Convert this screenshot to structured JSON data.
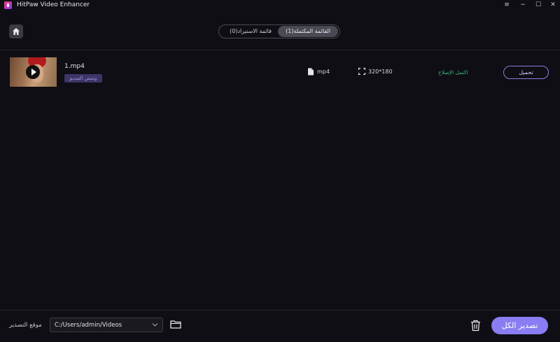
{
  "window": {
    "title": "HitPaw Video Enhancer"
  },
  "tabs": [
    {
      "label": "القائمة المكتملة(1)",
      "active": true
    },
    {
      "label": "قائمة الاستيراد(0)",
      "active": false
    }
  ],
  "file": {
    "name": "1.mp4",
    "tag": "ومبض الفيديو",
    "format": "mp4",
    "resolution": "320*180",
    "status": "اكتمل الإصلاح",
    "upload_label": "تحميل"
  },
  "footer": {
    "export_location_label": "موقع التصدير",
    "path_value": "C:/Users/admin/Videos",
    "export_all_label": "تصدير الكل"
  },
  "colors": {
    "accent": "#8a7cf2",
    "status_green": "#3fb87a",
    "background": "#0f0e14"
  },
  "icons": [
    "app-icon",
    "minimize-icon",
    "restore-icon",
    "close-icon",
    "home-icon",
    "play-icon",
    "file-icon",
    "resolution-icon",
    "chevron-down-icon",
    "folder-icon",
    "trash-icon"
  ]
}
